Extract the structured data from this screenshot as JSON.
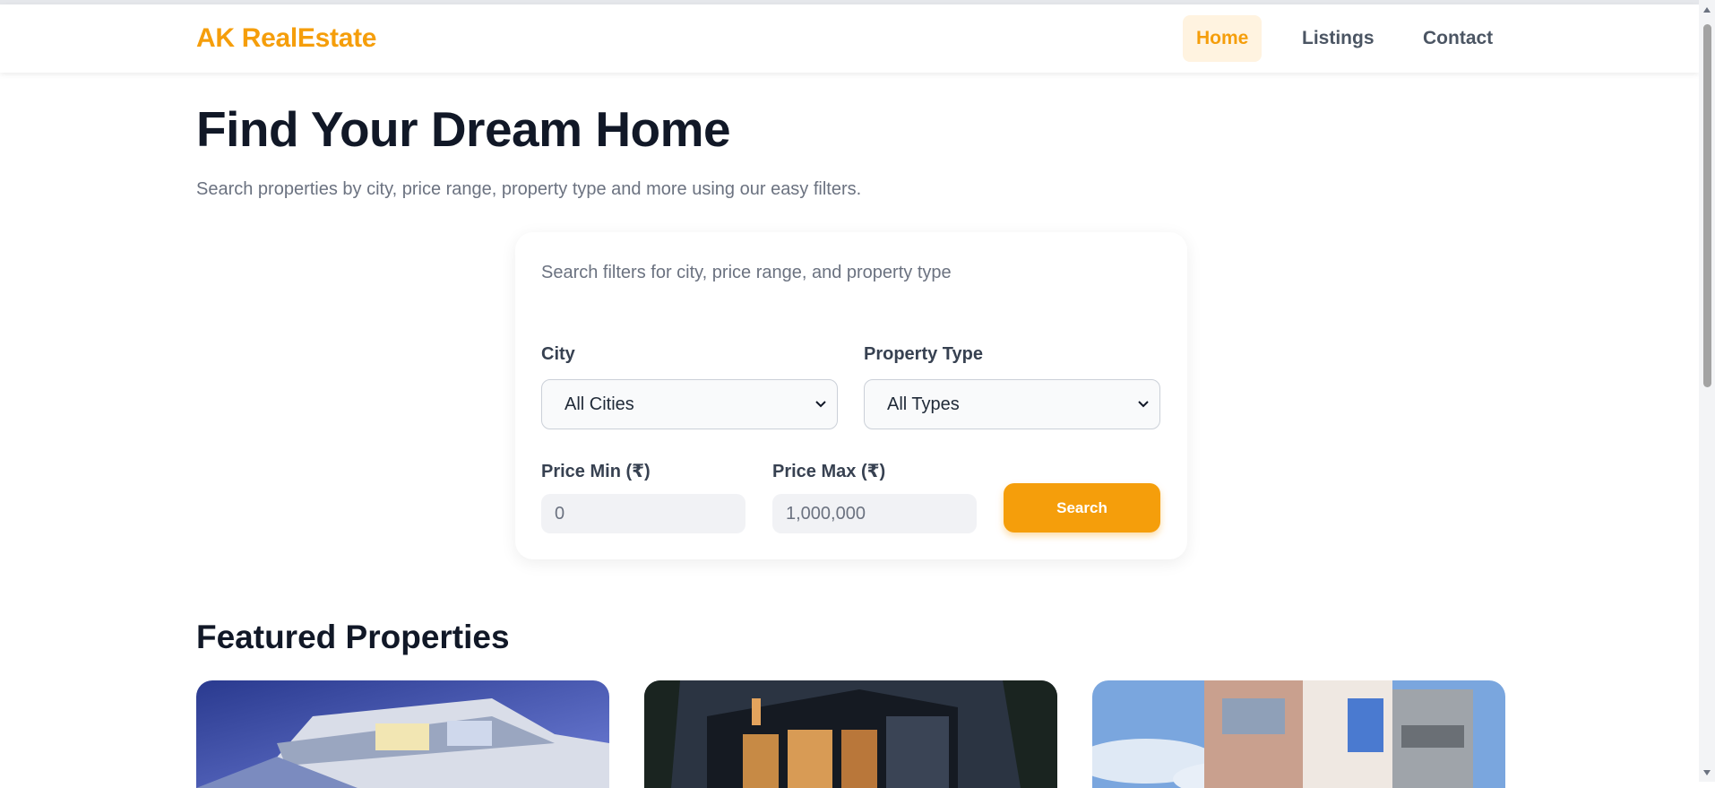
{
  "brand": {
    "name": "AK RealEstate",
    "accent_color": "#f59e0b"
  },
  "nav": {
    "items": [
      {
        "label": "Home",
        "active": true
      },
      {
        "label": "Listings",
        "active": false
      },
      {
        "label": "Contact",
        "active": false
      }
    ]
  },
  "hero": {
    "title": "Find Your Dream Home",
    "subtitle": "Search properties by city, price range, property type and more using our easy filters."
  },
  "filters": {
    "description": "Search filters for city, price range, and property type",
    "city": {
      "label": "City",
      "value": "All Cities"
    },
    "property_type": {
      "label": "Property Type",
      "value": "All Types"
    },
    "price_min": {
      "label": "Price Min (₹)",
      "placeholder": "0"
    },
    "price_max": {
      "label": "Price Max (₹)",
      "placeholder": "1,000,000"
    },
    "search_label": "Search"
  },
  "featured": {
    "title": "Featured Properties",
    "cards": [
      {
        "image": "modern-villa-photo"
      },
      {
        "image": "dark-modern-house-photo"
      },
      {
        "image": "townhouse-photo"
      }
    ]
  }
}
